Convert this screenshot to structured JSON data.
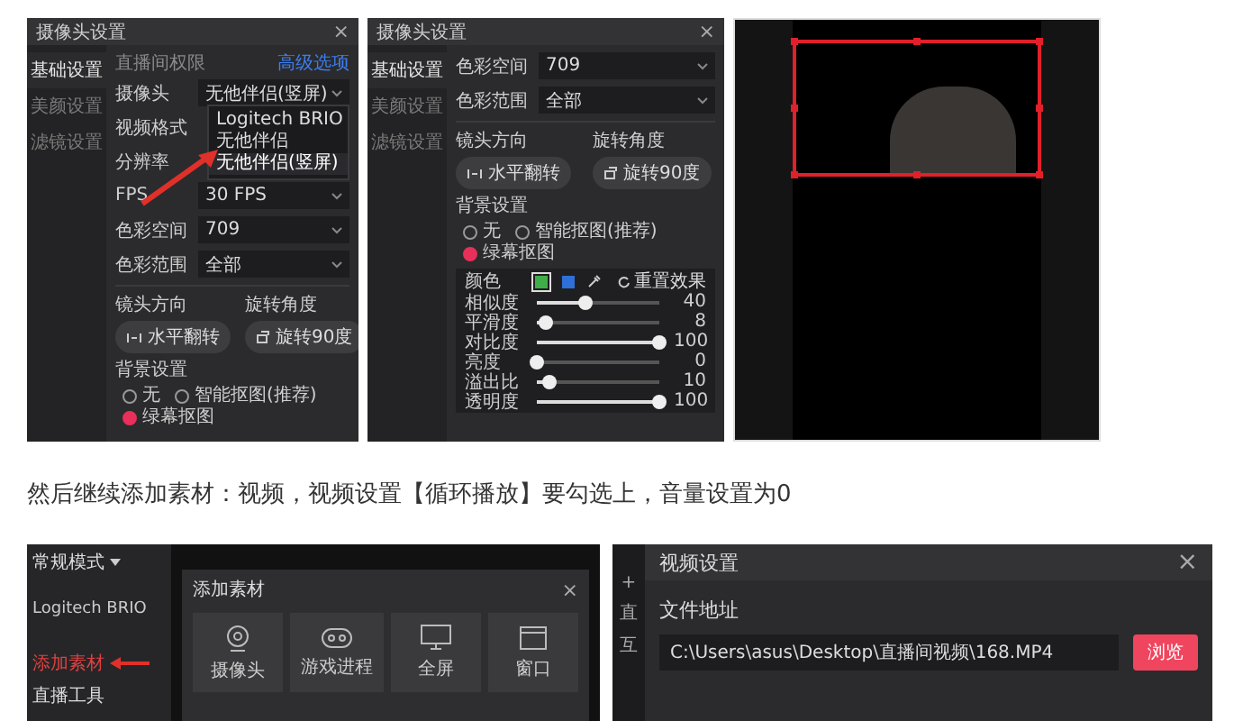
{
  "left_dialog": {
    "title": "摄像头设置",
    "close": "×",
    "nav": [
      {
        "label": "基础设置",
        "selected": true
      },
      {
        "label": "美颜设置",
        "selected": false
      },
      {
        "label": "滤镜设置",
        "selected": false
      }
    ],
    "section_label": "直播间权限",
    "link": "高级选项",
    "fields": [
      {
        "label": "摄像头",
        "value": "无他伴侣(竖屏)"
      },
      {
        "label": "视频格式"
      },
      {
        "label": "分辨率"
      },
      {
        "label": "FPS",
        "value": "30 FPS"
      },
      {
        "label": "色彩空间",
        "value": "709"
      },
      {
        "label": "色彩范围",
        "value": "全部"
      }
    ],
    "dropdown_options": [
      {
        "label": "Logitech BRIO",
        "selected": false
      },
      {
        "label": "无他伴侣",
        "selected": false
      },
      {
        "label": "无他伴侣(竖屏)",
        "selected": true
      }
    ],
    "lens_label": "镜头方向",
    "rotate_label": "旋转角度",
    "flip_button": "水平翻转",
    "rotate_button": "旋转90度",
    "bg_label": "背景设置",
    "bg_options": [
      {
        "label": "无",
        "selected": false
      },
      {
        "label": "智能抠图(推荐)",
        "selected": false
      },
      {
        "label": "绿幕抠图",
        "selected": true
      }
    ]
  },
  "right_dialog": {
    "title": "摄像头设置",
    "close": "×",
    "nav": [
      {
        "label": "基础设置",
        "selected": true
      },
      {
        "label": "美颜设置",
        "selected": false
      },
      {
        "label": "滤镜设置",
        "selected": false
      }
    ],
    "fields": [
      {
        "label": "色彩空间",
        "value": "709"
      },
      {
        "label": "色彩范围",
        "value": "全部"
      }
    ],
    "lens_label": "镜头方向",
    "rotate_label": "旋转角度",
    "flip_button": "水平翻转",
    "rotate_button": "旋转90度",
    "bg_label": "背景设置",
    "bg_options": [
      {
        "label": "无",
        "selected": false
      },
      {
        "label": "智能抠图(推荐)",
        "selected": false
      },
      {
        "label": "绿幕抠图",
        "selected": true
      }
    ],
    "chroma": {
      "color_label": "颜色",
      "swatches": [
        {
          "color": "#3fae49",
          "selected": true
        },
        {
          "color": "#2f6fd8",
          "selected": false
        }
      ],
      "reset": "重置效果",
      "sliders": [
        {
          "name": "相似度",
          "level": 0.4,
          "reading": "40"
        },
        {
          "name": "平滑度",
          "level": 0.08,
          "reading": "8"
        },
        {
          "name": "对比度",
          "level": 1,
          "reading": "100"
        },
        {
          "name": "亮度",
          "level": 0,
          "reading": "0"
        },
        {
          "name": "溢出比",
          "level": 0.1,
          "reading": "10"
        },
        {
          "name": "透明度",
          "level": 1,
          "reading": "100"
        }
      ]
    }
  },
  "caption": "然后继续添加素材：视频，视频设置【循环播放】要勾选上，音量设置为0",
  "app": {
    "mode": "常规模式",
    "device": "Logitech BRIO",
    "add_button": "添加素材",
    "tools_label": "直播工具",
    "modal": {
      "title": "添加素材",
      "close": "×",
      "tiles": [
        {
          "label": "摄像头",
          "kind": "camera"
        },
        {
          "label": "游戏进程",
          "kind": "game"
        },
        {
          "label": "全屏",
          "kind": "screen"
        },
        {
          "label": "窗口",
          "kind": "window"
        }
      ]
    }
  },
  "video_dialog": {
    "title": "视频设置",
    "close": "×",
    "side_plus": "+",
    "side_texts": [
      "直",
      "互"
    ],
    "file_label": "文件地址",
    "file_path": "C:\\Users\\asus\\Desktop\\直播间视频\\168.MP4",
    "browse": "浏览"
  }
}
